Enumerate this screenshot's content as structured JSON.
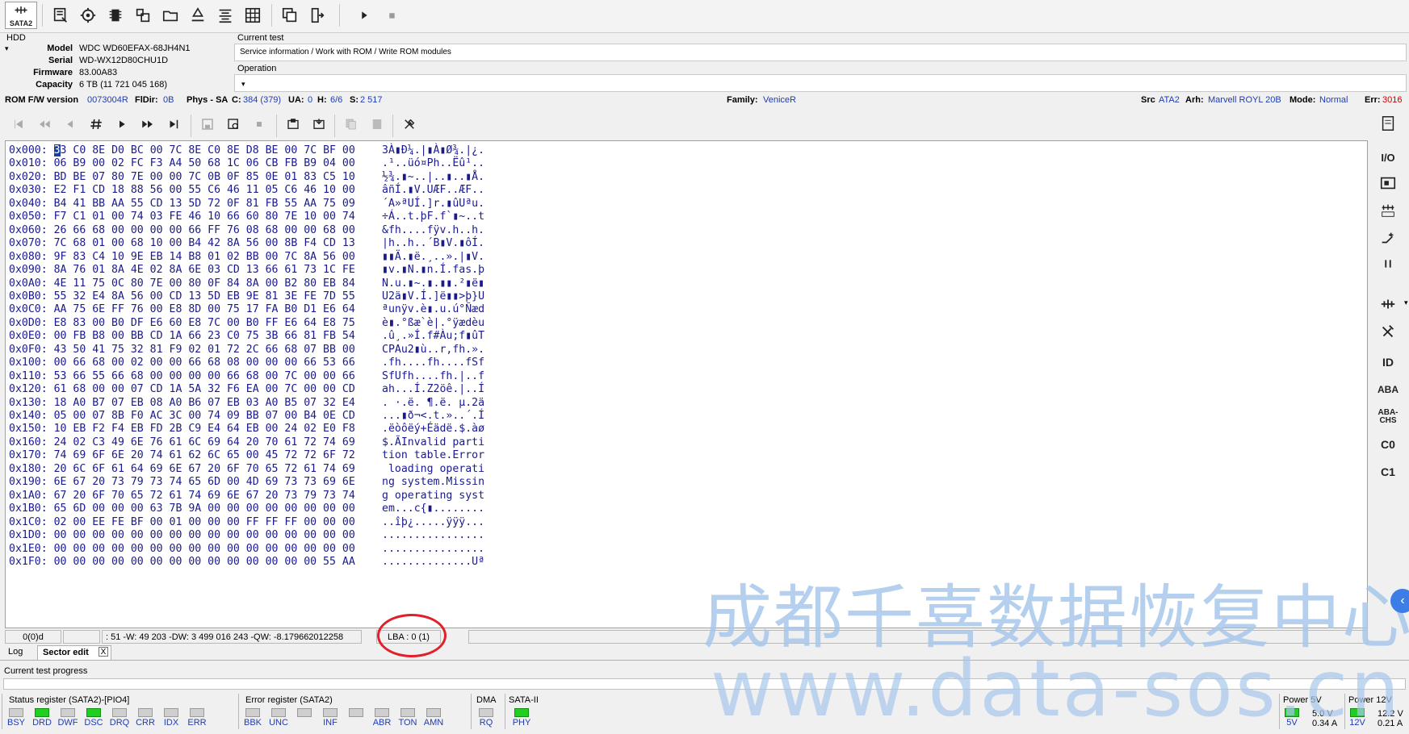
{
  "toolbar": {
    "sata_label": "SATA2"
  },
  "hdd": {
    "group_label": "HDD",
    "model_key": "Model",
    "model": "WDC WD60EFAX-68JH4N1",
    "serial_key": "Serial",
    "serial": "WD-WX12D80CHU1D",
    "firmware_key": "Firmware",
    "firmware": "83.00A83",
    "capacity_key": "Capacity",
    "capacity": "6 TB (11 721 045 168)"
  },
  "current_test": {
    "label": "Current test",
    "value": "Service information / Work with ROM / Write ROM modules"
  },
  "operation": {
    "label": "Operation",
    "value": ""
  },
  "status": {
    "rom_key": "ROM F/W version",
    "rom_val": "0073004R",
    "fldir_key": "FlDir:",
    "fldir_val": "0B",
    "phys_key": "Phys - SA",
    "c_key": "C:",
    "c_val": "384 (379)",
    "ua_key": "UA:",
    "ua_val": "0",
    "h_key": "H:",
    "h_val": "6/6",
    "s_key": "S:",
    "s_val": "2 517",
    "family_key": "Family:",
    "family_val": "VeniceR",
    "src_key": "Src",
    "src_val": "ATA2",
    "arh_key": "Arh:",
    "arh_val": "Marvell ROYL 20B",
    "mode_key": "Mode:",
    "mode_val": "Normal",
    "err_key": "Err:",
    "err_val": "3016"
  },
  "hex": {
    "rows": [
      {
        "off": "0x000:",
        "hex": "33 C0 8E D0 BC 00 7C 8E C0 8E D8 BE 00 7C BF 00",
        "asc": "3À▮Ð¼.|▮À▮Ø¾.|¿."
      },
      {
        "off": "0x010:",
        "hex": "06 B9 00 02 FC F3 A4 50 68 1C 06 CB FB B9 04 00",
        "asc": ".¹..üó¤Ph..Ëû¹.."
      },
      {
        "off": "0x020:",
        "hex": "BD BE 07 80 7E 00 00 7C 0B 0F 85 0E 01 83 C5 10",
        "asc": "½¾.▮~..|..▮..▮Å."
      },
      {
        "off": "0x030:",
        "hex": "E2 F1 CD 18 88 56 00 55 C6 46 11 05 C6 46 10 00",
        "asc": "âñÍ.▮V.UÆF..ÆF.."
      },
      {
        "off": "0x040:",
        "hex": "B4 41 BB AA 55 CD 13 5D 72 0F 81 FB 55 AA 75 09",
        "asc": "´A»ªUÍ.]r.▮ûUªu."
      },
      {
        "off": "0x050:",
        "hex": "F7 C1 01 00 74 03 FE 46 10 66 60 80 7E 10 00 74",
        "asc": "÷Á..t.þF.f`▮~..t"
      },
      {
        "off": "0x060:",
        "hex": "26 66 68 00 00 00 00 66 FF 76 08 68 00 00 68 00",
        "asc": "&fh....fÿv.h..h."
      },
      {
        "off": "0x070:",
        "hex": "7C 68 01 00 68 10 00 B4 42 8A 56 00 8B F4 CD 13",
        "asc": "|h..h..´B▮V.▮ôÍ."
      },
      {
        "off": "0x080:",
        "hex": "9F 83 C4 10 9E EB 14 B8 01 02 BB 00 7C 8A 56 00",
        "asc": "▮▮Ä.▮ë.¸..».|▮V."
      },
      {
        "off": "0x090:",
        "hex": "8A 76 01 8A 4E 02 8A 6E 03 CD 13 66 61 73 1C FE",
        "asc": "▮v.▮N.▮n.Í.fas.þ"
      },
      {
        "off": "0x0A0:",
        "hex": "4E 11 75 0C 80 7E 00 80 0F 84 8A 00 B2 80 EB 84",
        "asc": "N.u.▮~.▮.▮▮.²▮ë▮"
      },
      {
        "off": "0x0B0:",
        "hex": "55 32 E4 8A 56 00 CD 13 5D EB 9E 81 3E FE 7D 55",
        "asc": "U2ä▮V.Í.]ë▮▮>þ}U"
      },
      {
        "off": "0x0C0:",
        "hex": "AA 75 6E FF 76 00 E8 8D 00 75 17 FA B0 D1 E6 64",
        "asc": "ªunÿv.è▮.u.ú°Ñæd"
      },
      {
        "off": "0x0D0:",
        "hex": "E8 83 00 B0 DF E6 60 E8 7C 00 B0 FF E6 64 E8 75",
        "asc": "è▮.°ßæ`è|.°ÿædèu"
      },
      {
        "off": "0x0E0:",
        "hex": "00 FB B8 00 BB CD 1A 66 23 C0 75 3B 66 81 FB 54",
        "asc": ".û¸.»Í.f#Àu;f▮ûT"
      },
      {
        "off": "0x0F0:",
        "hex": "43 50 41 75 32 81 F9 02 01 72 2C 66 68 07 BB 00",
        "asc": "CPAu2▮ù..r,fh.»."
      },
      {
        "off": "0x100:",
        "hex": "00 66 68 00 02 00 00 66 68 08 00 00 00 66 53 66",
        "asc": ".fh....fh....fSf"
      },
      {
        "off": "0x110:",
        "hex": "53 66 55 66 68 00 00 00 00 66 68 00 7C 00 00 66",
        "asc": "SfUfh....fh.|..f"
      },
      {
        "off": "0x120:",
        "hex": "61 68 00 00 07 CD 1A 5A 32 F6 EA 00 7C 00 00 CD",
        "asc": "ah...Í.Z2öê.|..Í"
      },
      {
        "off": "0x130:",
        "hex": "18 A0 B7 07 EB 08 A0 B6 07 EB 03 A0 B5 07 32 E4",
        "asc": ". ·.ë. ¶.ë. µ.2ä"
      },
      {
        "off": "0x140:",
        "hex": "05 00 07 8B F0 AC 3C 00 74 09 BB 07 00 B4 0E CD",
        "asc": "...▮ð¬<.t.»..´.Í"
      },
      {
        "off": "0x150:",
        "hex": "10 EB F2 F4 EB FD 2B C9 E4 64 EB 00 24 02 E0 F8",
        "asc": ".ëòôëý+Éädë.$.àø"
      },
      {
        "off": "0x160:",
        "hex": "24 02 C3 49 6E 76 61 6C 69 64 20 70 61 72 74 69",
        "asc": "$.ÃInvalid parti"
      },
      {
        "off": "0x170:",
        "hex": "74 69 6F 6E 20 74 61 62 6C 65 00 45 72 72 6F 72",
        "asc": "tion table.Error"
      },
      {
        "off": "0x180:",
        "hex": "20 6C 6F 61 64 69 6E 67 20 6F 70 65 72 61 74 69",
        "asc": " loading operati"
      },
      {
        "off": "0x190:",
        "hex": "6E 67 20 73 79 73 74 65 6D 00 4D 69 73 73 69 6E",
        "asc": "ng system.Missin"
      },
      {
        "off": "0x1A0:",
        "hex": "67 20 6F 70 65 72 61 74 69 6E 67 20 73 79 73 74",
        "asc": "g operating syst"
      },
      {
        "off": "0x1B0:",
        "hex": "65 6D 00 00 00 63 7B 9A 00 00 00 00 00 00 00 00",
        "asc": "em...c{▮........"
      },
      {
        "off": "0x1C0:",
        "hex": "02 00 EE FE BF 00 01 00 00 00 FF FF FF 00 00 00",
        "asc": "..îþ¿.....ÿÿÿ..."
      },
      {
        "off": "0x1D0:",
        "hex": "00 00 00 00 00 00 00 00 00 00 00 00 00 00 00 00",
        "asc": "................"
      },
      {
        "off": "0x1E0:",
        "hex": "00 00 00 00 00 00 00 00 00 00 00 00 00 00 00 00",
        "asc": "................"
      },
      {
        "off": "0x1F0:",
        "hex": "00 00 00 00 00 00 00 00 00 00 00 00 00 00 55 AA",
        "asc": "..............Uª"
      }
    ]
  },
  "hexstatus": {
    "cell1": "0(0)d",
    "cell2": ": 51 -W: 49 203 -DW: 3 499 016 243 -QW: -8.179662012258",
    "lba": "LBA : 0 (1)"
  },
  "tabs": {
    "log": "Log",
    "sector_edit": "Sector edit",
    "close": "X"
  },
  "progress": {
    "label": "Current test progress"
  },
  "sidebar": {
    "io_label": "I/O",
    "id_label": "ID",
    "aba_label": "ABA",
    "aba_chs_top": "ABA-",
    "aba_chs_bottom": "CHS",
    "c0_label": "C0",
    "c1_label": "C1"
  },
  "status_register": {
    "title": "Status register (SATA2)-[PIO4]",
    "leds": [
      {
        "label": "BSY",
        "on": false
      },
      {
        "label": "DRD",
        "on": true
      },
      {
        "label": "DWF",
        "on": false
      },
      {
        "label": "DSC",
        "on": true
      },
      {
        "label": "DRQ",
        "on": false
      },
      {
        "label": "CRR",
        "on": false
      },
      {
        "label": "IDX",
        "on": false
      },
      {
        "label": "ERR",
        "on": false
      }
    ]
  },
  "error_register": {
    "title": "Error register (SATA2)",
    "leds": [
      {
        "label": "BBK",
        "on": false
      },
      {
        "label": "UNC",
        "on": false
      },
      {
        "label": "",
        "on": false
      },
      {
        "label": "INF",
        "on": false
      },
      {
        "label": "",
        "on": false
      },
      {
        "label": "ABR",
        "on": false
      },
      {
        "label": "TON",
        "on": false
      },
      {
        "label": "AMN",
        "on": false
      }
    ]
  },
  "dma": {
    "title": "DMA",
    "led_label": "RQ",
    "on": false
  },
  "sata2": {
    "title": "SATA-II",
    "led_label": "PHY",
    "on": true
  },
  "power5": {
    "title": "Power 5V",
    "led_label": "5V",
    "volt": "5.0 V",
    "amp": "0.34 A"
  },
  "power12": {
    "title": "Power 12V",
    "led_label": "12V",
    "volt": "12.2 V",
    "amp": "0.21 A"
  },
  "watermark": {
    "line1": "成都千喜数据恢复中心",
    "line2": "www.data-sos.cn"
  },
  "colors": {
    "blue_text": "#1f3cb0",
    "led_on": "#20d020",
    "err_red": "#d00000"
  }
}
